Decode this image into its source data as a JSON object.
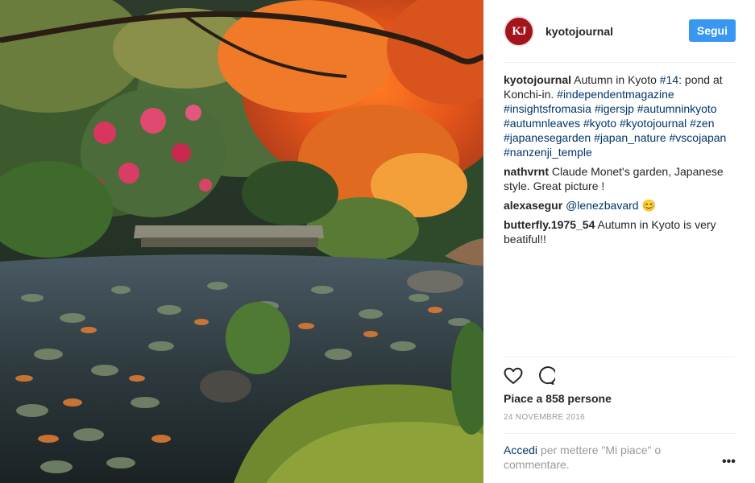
{
  "post": {
    "author": "kyotojournal",
    "avatar_initials": "KJ",
    "follow_label": "Segui",
    "caption": {
      "user": "kyotojournal",
      "text_1": "Autumn in Kyoto ",
      "tag_14": "#14",
      "text_2": ": pond at Konchi-in. ",
      "tags": "#independentmagazine #insightsfromasia #igersjp #autumninkyoto #autumnleaves #kyoto #kyotojournal #zen #japanesegarden #japan_nature #vscojapan #nanzenji_temple"
    },
    "comments": [
      {
        "user": "nathvrnt",
        "text": "Claude Monet's garden, Japanese style. Great picture !"
      },
      {
        "user": "alexasegur",
        "mention": "@lenezbavard",
        "emoji": "😊"
      },
      {
        "user": "butterfly.1975_54",
        "text": "Autumn in Kyoto is very beatiful!!"
      }
    ],
    "likes_text": "Piace a 858 persone",
    "date": "24 NOVEMBRE 2016",
    "login_link": "Accedi",
    "login_rest": "per mettere \"Mi piace\" o commentare.",
    "more_label": "•••"
  },
  "colors": {
    "accent": "#3897f0",
    "link": "#003569",
    "muted": "#999999",
    "brand": "#a5141b"
  },
  "icons": [
    "heart-icon",
    "comment-icon",
    "more-icon"
  ]
}
